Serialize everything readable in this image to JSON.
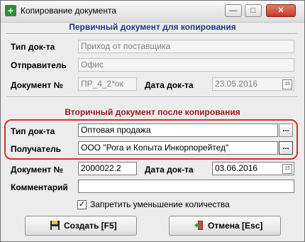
{
  "window": {
    "title": "Копирование документа"
  },
  "titlebar": {
    "minimize": "—",
    "maximize": "□",
    "close": "✕"
  },
  "primary": {
    "heading": "Первичный документ для копирования",
    "doc_type_label": "Тип док-та",
    "doc_type_value": "Приход от поставщика",
    "sender_label": "Отправитель",
    "sender_value": "Офис",
    "doc_no_label": "Документ №",
    "doc_no_value": "ПР_4_2*ок",
    "doc_date_label": "Дата док-та",
    "doc_date_value": "23.05.2016"
  },
  "secondary": {
    "heading": "Вторичный документ после копирования",
    "doc_type_label": "Тип док-та",
    "doc_type_value": "Оптовая продажа",
    "recipient_label": "Получатель",
    "recipient_value": "ООО \"Рога и Копыта Инкорпорейтед\"",
    "doc_no_label": "Документ №",
    "doc_no_value": "2000022.2",
    "doc_date_label": "Дата док-та",
    "doc_date_value": "03.06.2016",
    "comment_label": "Комментарий",
    "comment_value": ""
  },
  "ellipsis": "...",
  "calendar_glyph": "15",
  "options": {
    "forbid_decrease_label": "Запретить уменьшение количества",
    "forbid_decrease_checked": true,
    "check_mark": "✓"
  },
  "buttons": {
    "create_label": "Создать [F5]",
    "cancel_label": "Отмена [Esc]"
  },
  "colors": {
    "primary_heading": "#1f3a8a",
    "secondary_heading": "#9b1b1b",
    "highlight": "#d22f2f"
  }
}
